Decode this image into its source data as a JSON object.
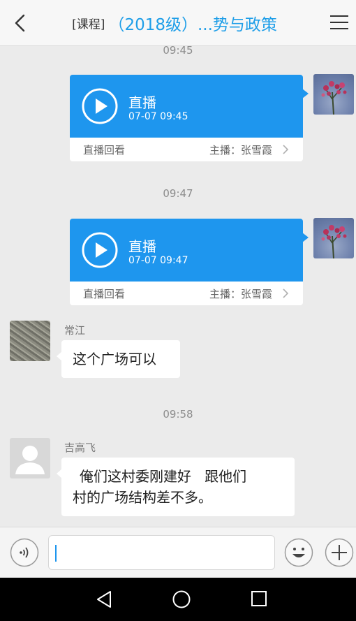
{
  "header": {
    "prefix": "[课程]",
    "title": "（2018级）...势与政策"
  },
  "chat": {
    "times": [
      "09:45",
      "09:47",
      "09:58"
    ],
    "live_cards": [
      {
        "title": "直播",
        "datetime": "07-07 09:45",
        "replay_label": "直播回看",
        "host_label": "主播：张雪霞"
      },
      {
        "title": "直播",
        "datetime": "07-07 09:47",
        "replay_label": "直播回看",
        "host_label": "主播：张雪霞"
      }
    ],
    "messages": [
      {
        "sender": "常江",
        "text": "这个广场可以"
      },
      {
        "sender": "吉高飞",
        "line1": "俺们这村委刚建好   跟他们",
        "line2": "村的广场结构差不多。"
      }
    ]
  },
  "input_bar": {
    "value": "",
    "placeholder": ""
  },
  "colors": {
    "accent": "#1e96ee",
    "title": "#1e9ee8",
    "background": "#ebebeb"
  },
  "icons": [
    "back-arrow-icon",
    "menu-icon",
    "play-icon",
    "chevron-right-icon",
    "voice-icon",
    "emoji-icon",
    "plus-icon",
    "nav-back-icon",
    "nav-home-icon",
    "nav-recent-icon"
  ]
}
